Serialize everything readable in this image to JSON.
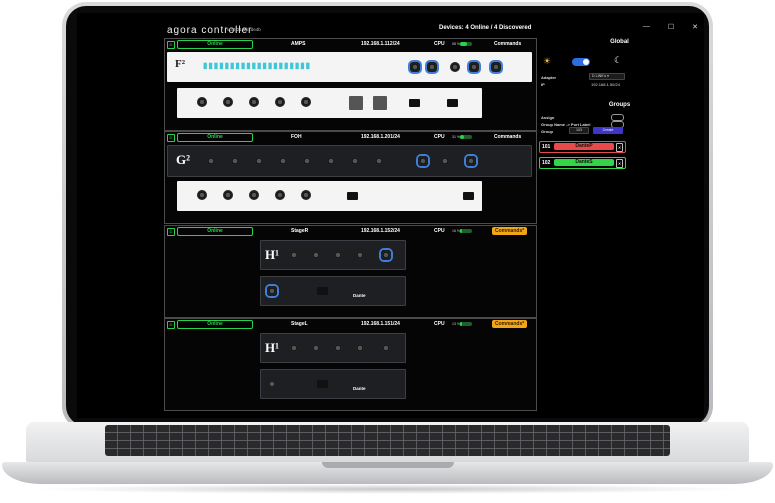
{
  "app": {
    "logo": "agora controller",
    "version": "v0.3.21-9b1de4b",
    "devices_status": "Devices: 4 Online / 4 Discovered",
    "window_buttons": [
      "—",
      "☐",
      "✕"
    ]
  },
  "devices": [
    {
      "status": "Online",
      "name": "AMPS",
      "ip": "192.168.1.112/24",
      "cpu_label": "CPU",
      "cpu_value": "58 %",
      "cpu_fraction": 0.58,
      "commands": "Commands",
      "commands_warn": false
    },
    {
      "status": "Online",
      "name": "FOH",
      "ip": "192.168.1.201/24",
      "cpu_label": "CPU",
      "cpu_value": "31 %",
      "cpu_fraction": 0.31,
      "commands": "Commands",
      "commands_warn": false
    },
    {
      "status": "Online",
      "name": "StageR",
      "ip": "192.168.1.152/24",
      "cpu_label": "CPU",
      "cpu_value": "16 %",
      "cpu_fraction": 0.16,
      "commands": "Commands*",
      "commands_warn": true
    },
    {
      "status": "Online",
      "name": "StageL",
      "ip": "192.168.1.151/24",
      "cpu_label": "CPU",
      "cpu_value": "13 %",
      "cpu_fraction": 0.13,
      "commands": "Commands*",
      "commands_warn": true
    }
  ],
  "global": {
    "title": "Global",
    "adapter_label": "Adapter",
    "adapter_value": "D LINK's ▾",
    "ip_label": "IP",
    "ip_value": "192.168.1.50/24"
  },
  "groups": {
    "title": "Groups",
    "assign_label": "Assign",
    "name_port_label": "Group Name -> Port Label",
    "group_label": "Group",
    "group_number": "103",
    "create_label": "Create",
    "items": [
      {
        "number": "101",
        "name": "DanteP",
        "color": "#e84a4a"
      },
      {
        "number": "102",
        "name": "DanteS",
        "color": "#34d449"
      }
    ]
  },
  "panels": {
    "f2_label": "F²",
    "g2_label": "G²",
    "h1_label": "H¹",
    "dante_label": "Dante"
  }
}
